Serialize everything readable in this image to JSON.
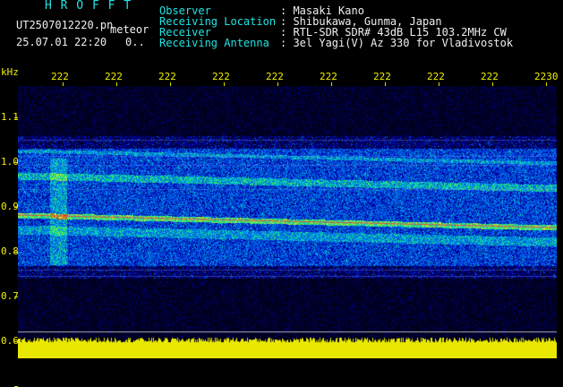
{
  "header": {
    "title": "H R O F F T",
    "file_name": "UT2507012220.pn",
    "type": "meteor",
    "datetime": "25.07.01 22:20",
    "counter": "0..",
    "info": [
      {
        "label": "Observer",
        "value": ": Masaki Kano"
      },
      {
        "label": "Receiving Location",
        "value": ": Shibukawa, Gunma, Japan"
      },
      {
        "label": "Receiver",
        "value": ": RTL-SDR SDR# 43dB L15 103.2MHz CW"
      },
      {
        "label": "Receiving Antenna",
        "value": ": 3el Yagi(V) Az 330 for Vladivostok"
      }
    ]
  },
  "plot": {
    "y_unit": "kHz",
    "y_ticks": [
      "1.1",
      "1.0",
      "0.9",
      "0.8",
      "0.7",
      "0.6"
    ],
    "x_ticks": [
      "222",
      "222",
      "222",
      "222",
      "222",
      "222",
      "222",
      "222",
      "222",
      "2230"
    ]
  },
  "colors": {
    "title": "#21e3e3",
    "header_labels": "#21e3e3",
    "header_values": "#f0f0f0",
    "axis": "#f0f000",
    "background": "#000000"
  }
}
